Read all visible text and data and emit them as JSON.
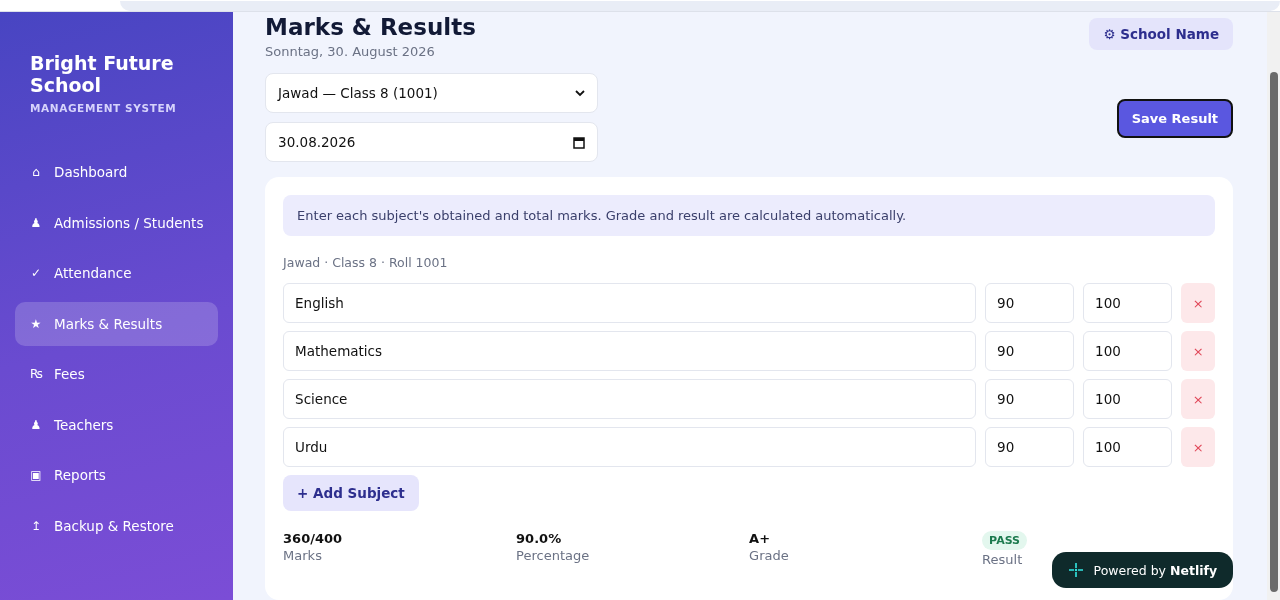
{
  "sidebar": {
    "title": "Bright Future School",
    "subtitle": "MANAGEMENT SYSTEM",
    "items": [
      {
        "icon": "⌂",
        "label": "Dashboard",
        "selected": false
      },
      {
        "icon": "♟",
        "label": "Admissions / Students",
        "selected": false
      },
      {
        "icon": "✓",
        "label": "Attendance",
        "selected": false
      },
      {
        "icon": "★",
        "label": "Marks & Results",
        "selected": true
      },
      {
        "icon": "₨",
        "label": "Fees",
        "selected": false
      },
      {
        "icon": "♟",
        "label": "Teachers",
        "selected": false
      },
      {
        "icon": "▣",
        "label": "Reports",
        "selected": false
      },
      {
        "icon": "↥",
        "label": "Backup & Restore",
        "selected": false
      }
    ]
  },
  "header": {
    "title": "Marks & Results",
    "date": "Sonntag, 30. August 2026",
    "settings_button": "⚙ School Name"
  },
  "student_select": {
    "value": "Jawad — Class 8 (1001)"
  },
  "date_field": {
    "value": "30.08.2026"
  },
  "save_button": "Save Result",
  "card": {
    "info": "Enter each subject's obtained and total marks. Grade and result are calculated automatically.",
    "student_meta": "Jawad · Class 8 · Roll 1001",
    "subjects": [
      {
        "name": "English",
        "obtained": "90",
        "total": "100",
        "remove": "×"
      },
      {
        "name": "Mathematics",
        "obtained": "90",
        "total": "100",
        "remove": "×"
      },
      {
        "name": "Science",
        "obtained": "90",
        "total": "100",
        "remove": "×"
      },
      {
        "name": "Urdu",
        "obtained": "90",
        "total": "100",
        "remove": "×"
      }
    ],
    "add_button": "+ Add Subject",
    "summary": [
      {
        "kind": "text",
        "value": "360/400",
        "label": "Marks"
      },
      {
        "kind": "text",
        "value": "90.0%",
        "label": "Percentage"
      },
      {
        "kind": "text",
        "value": "A+",
        "label": "Grade"
      },
      {
        "kind": "badge",
        "value": "PASS",
        "label": "Result"
      }
    ]
  },
  "badge": {
    "text": "Powered by ",
    "brand": "Netlify"
  }
}
